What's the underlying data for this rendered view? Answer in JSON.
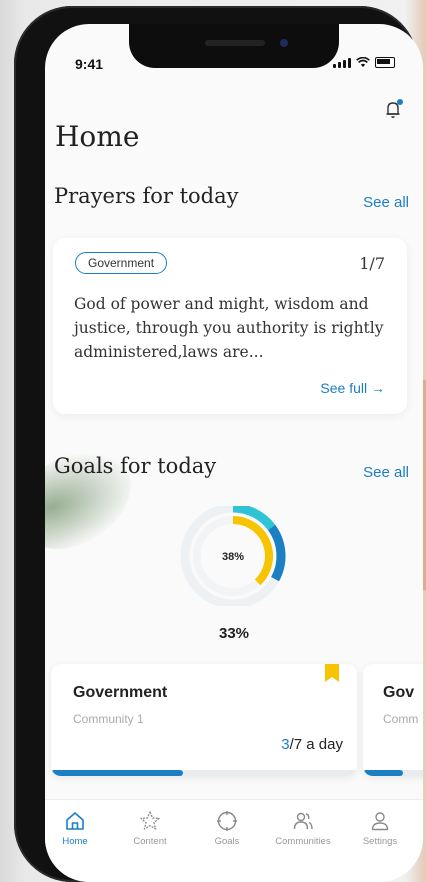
{
  "status_bar": {
    "time": "9:41"
  },
  "header": {
    "title": "Home"
  },
  "prayers": {
    "section_title": "Prayers for today",
    "see_all": "See all",
    "card": {
      "tag": "Government",
      "counter": "1/7",
      "text": "God of power and might, wisdom and justice,  through you authority is rightly administered,laws are...",
      "see_full": "See full →"
    }
  },
  "goals": {
    "section_title": "Goals for today",
    "see_all": "See all",
    "ring": {
      "inner_percent_label": "38%",
      "inner_value": 0.38,
      "outer_value": 0.33,
      "overall_label": "33%"
    },
    "cards": [
      {
        "title": "Government",
        "subtitle": "Community 1",
        "done": "3",
        "freq": "/7 a day",
        "progress": 0.43
      },
      {
        "title": "Gov",
        "subtitle": "Comm",
        "progress": 0.5
      }
    ]
  },
  "nav": [
    {
      "label": "Home",
      "icon": "home-icon",
      "active": true
    },
    {
      "label": "Content",
      "icon": "star-icon"
    },
    {
      "label": "Goals",
      "icon": "target-icon"
    },
    {
      "label": "Communities",
      "icon": "people-icon"
    },
    {
      "label": "Settings",
      "icon": "user-icon"
    }
  ],
  "colors": {
    "accent": "#1c7fc4",
    "ring_yellow": "#f6c400",
    "ring_cyan": "#2ec4d6"
  }
}
